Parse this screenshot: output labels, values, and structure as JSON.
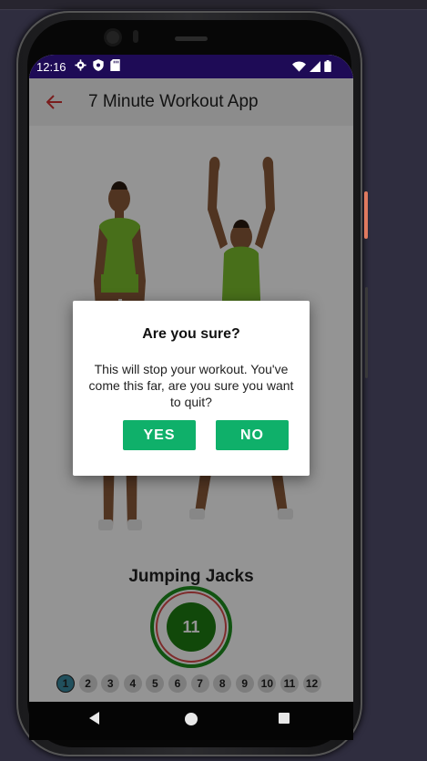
{
  "status_bar": {
    "time": "12:16",
    "left_icons": [
      "gear-icon",
      "shield-icon",
      "sd-card-icon"
    ],
    "right_icons": [
      "wifi-icon",
      "signal-icon",
      "battery-icon"
    ],
    "background": "#1e0b56"
  },
  "toolbar": {
    "back_icon": "arrow-left-icon",
    "title": "7 Minute Workout App",
    "accent": "#d33333"
  },
  "exercise": {
    "name": "Jumping Jacks",
    "timer_value": "11",
    "timer_color": "#1e7d12"
  },
  "progress": {
    "steps": [
      "1",
      "2",
      "3",
      "4",
      "5",
      "6",
      "7",
      "8",
      "9",
      "10",
      "11",
      "12"
    ],
    "current_step": "1"
  },
  "dialog": {
    "title": "Are you sure?",
    "message": "This will stop your workout. You've come this far, are you sure you want to quit?",
    "yes_label": "YES",
    "no_label": "NO",
    "button_color": "#0fb06a"
  },
  "nav_bar": {
    "icons": [
      "back-triangle-icon",
      "home-circle-icon",
      "recents-square-icon"
    ]
  }
}
